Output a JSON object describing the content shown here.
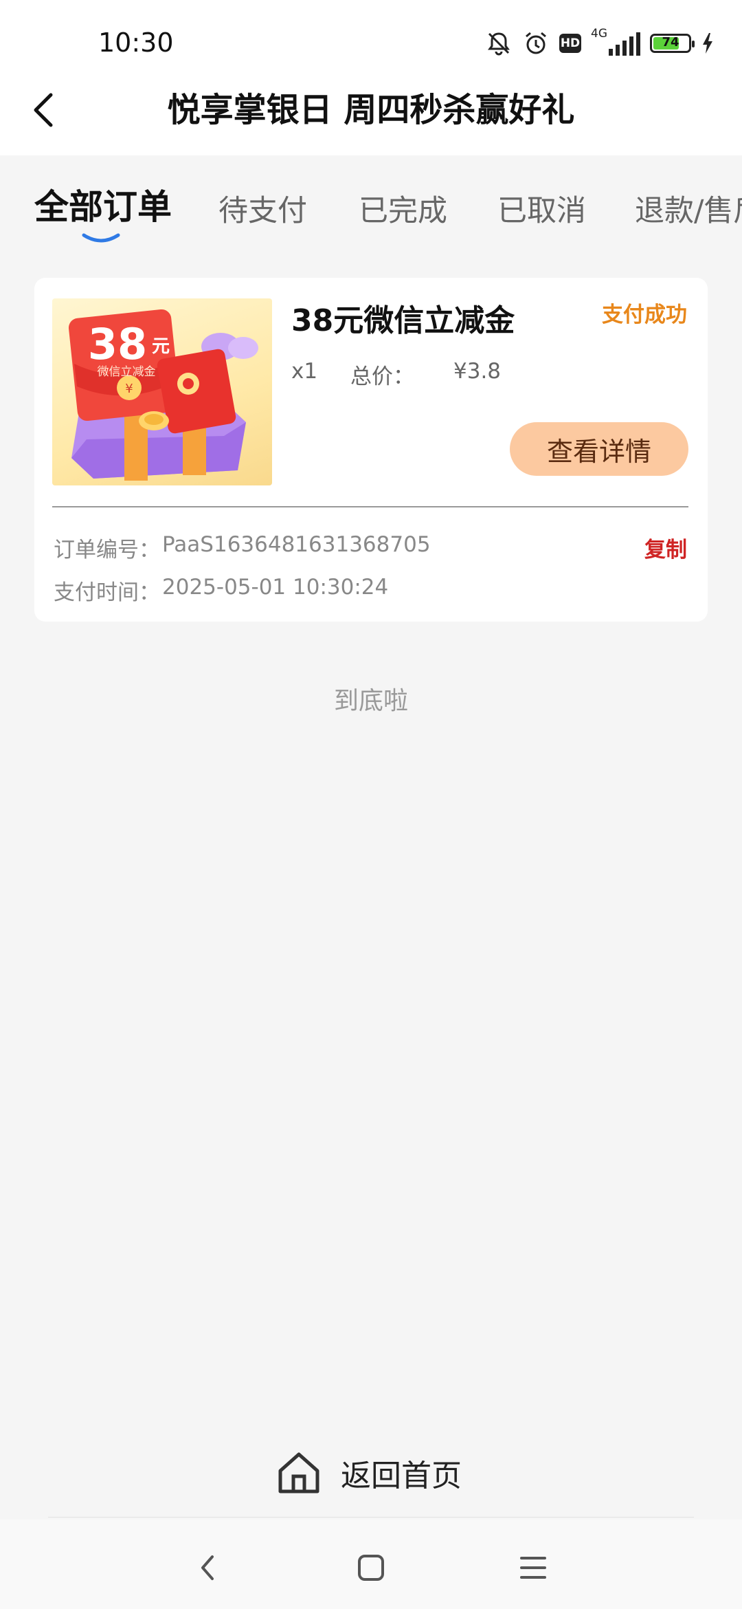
{
  "status_bar": {
    "time": "10:30",
    "network": "4G",
    "hd_label": "HD",
    "battery_level": 74,
    "battery_text": "74",
    "icons": [
      "bell-muted-icon",
      "alarm-icon",
      "hd-icon",
      "signal-icon",
      "battery-icon",
      "charging-icon"
    ]
  },
  "header": {
    "title": "悦享掌银日 周四秒杀赢好礼",
    "back_icon": "chevron-left-icon"
  },
  "tabs": [
    {
      "label": "全部订单",
      "active": true
    },
    {
      "label": "待支付",
      "active": false
    },
    {
      "label": "已完成",
      "active": false
    },
    {
      "label": "已取消",
      "active": false
    },
    {
      "label": "退款/售后",
      "active": false
    }
  ],
  "order": {
    "thumbnail": {
      "amount": "38",
      "unit": "元",
      "caption": "微信立减金"
    },
    "title": "38元微信立减金",
    "status": "支付成功",
    "quantity": "x1",
    "total_label": "总价：",
    "total_value": "¥3.8",
    "detail_button": "查看详情",
    "order_no_label": "订单编号：",
    "order_no_value": "PaaS1636481631368705",
    "copy_label": "复制",
    "pay_time_label": "支付时间：",
    "pay_time_value": "2025-05-01 10:30:24"
  },
  "bottom_hint": "到底啦",
  "home_button": {
    "label": "返回首页",
    "icon": "home-icon"
  },
  "nav_bar": {
    "icons": [
      "nav-back-icon",
      "nav-home-icon",
      "nav-menu-icon"
    ]
  },
  "colors": {
    "status_success": "#e8871b",
    "copy": "#cf2424",
    "detail_button_bg": "#fcc9a0",
    "tab_indicator": "#2f7ae5",
    "battery": "#5bd23a"
  }
}
